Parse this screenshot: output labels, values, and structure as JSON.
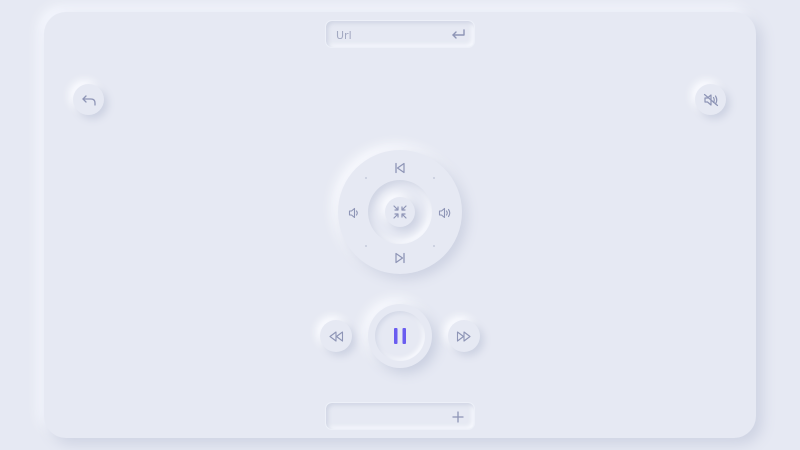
{
  "url_bar": {
    "placeholder": "Url",
    "value": "",
    "submit_icon": "enter-return-icon"
  },
  "add_bar": {
    "placeholder": "",
    "value": "",
    "add_icon": "plus-icon"
  },
  "top_controls": {
    "back_icon": "undo-arrow-icon",
    "mute_icon": "speaker-muted-icon"
  },
  "dial": {
    "up_icon": "skip-back-icon",
    "down_icon": "skip-forward-icon",
    "left_icon": "volume-low-icon",
    "right_icon": "volume-high-icon",
    "center_icon": "fullscreen-collapse-icon"
  },
  "transport": {
    "rewind_icon": "rewind-icon",
    "play_pause_icon": "pause-icon",
    "forward_icon": "fast-forward-icon"
  },
  "colors": {
    "background": "#e6e9f3",
    "icon": "#8e95b6",
    "accent": "#6a5df0"
  }
}
